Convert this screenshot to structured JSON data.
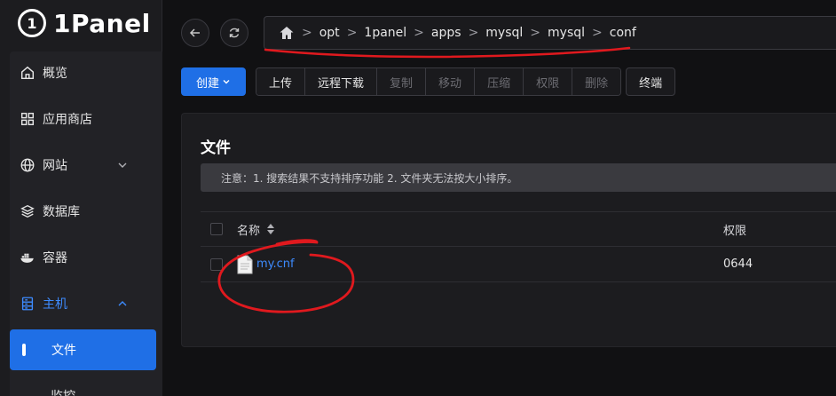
{
  "brand": {
    "name": "1Panel",
    "logo_mark": "1"
  },
  "sidebar": {
    "items": [
      {
        "label": "概览",
        "icon": "home-icon"
      },
      {
        "label": "应用商店",
        "icon": "grid-icon"
      },
      {
        "label": "网站",
        "icon": "globe-icon",
        "expandable": true
      },
      {
        "label": "数据库",
        "icon": "layers-icon"
      },
      {
        "label": "容器",
        "icon": "docker-icon"
      },
      {
        "label": "主机",
        "icon": "server-icon",
        "expanded": true
      }
    ],
    "active_sub": "文件",
    "next_sub_partial": "监控"
  },
  "topbar": {
    "back_icon": "arrow-left-icon",
    "refresh_icon": "refresh-icon"
  },
  "breadcrumb": {
    "home_icon": "house-icon",
    "separator": ">",
    "segments": [
      "opt",
      "1panel",
      "apps",
      "mysql",
      "mysql",
      "conf"
    ]
  },
  "toolbar": {
    "create": "创建",
    "upload": "上传",
    "remote_download": "远程下载",
    "copy": "复制",
    "move": "移动",
    "compress": "压缩",
    "permission": "权限",
    "delete": "删除",
    "terminal": "终端"
  },
  "files": {
    "title": "文件",
    "notice": "注意：1. 搜索结果不支持排序功能 2. 文件夹无法按大小排序。",
    "columns": {
      "name": "名称",
      "permission": "权限"
    },
    "rows": [
      {
        "name": "my.cnf",
        "permission": "0644",
        "icon": "file-icon"
      }
    ]
  },
  "colors": {
    "accent": "#1f6fe6",
    "link": "#3d8bff",
    "annotation": "#e0191e"
  }
}
